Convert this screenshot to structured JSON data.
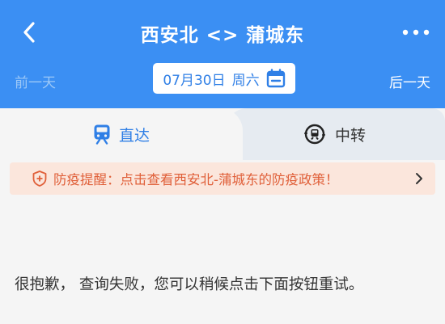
{
  "header": {
    "title": "西安北 <> 蒲城东",
    "back_icon": "back-chevron-icon",
    "more_icon": "more-dots-icon"
  },
  "date_bar": {
    "prev_label": "前一天",
    "date": "07月30日",
    "weekday": "周六",
    "next_label": "后一天",
    "calendar_icon": "calendar-icon"
  },
  "tabs": [
    {
      "label": "直达",
      "icon": "train-icon",
      "active": true
    },
    {
      "label": "中转",
      "icon": "transfer-icon",
      "active": false
    }
  ],
  "notice": {
    "text": "防疫提醒：点击查看西安北-蒲城东的防疫政策！",
    "icon": "shield-plus-icon"
  },
  "message": {
    "text": "很抱歉， 查询失败，您可以稍候点击下面按钮重试。"
  },
  "colors": {
    "header_bg": "#3b8ff3",
    "accent": "#2f7fe6",
    "notice_bg": "#fbe6dc",
    "notice_text": "#e0603a"
  }
}
